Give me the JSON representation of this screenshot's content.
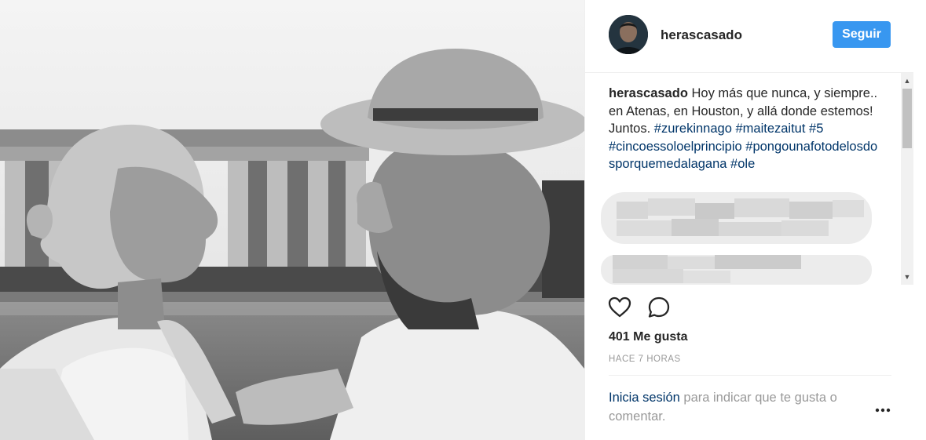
{
  "photo": {
    "alt_icon": "photo"
  },
  "header": {
    "username": "herascasado",
    "follow_label": "Seguir"
  },
  "caption": {
    "username": "herascasado",
    "text": "Hoy más que nunca, y siempre.. en Atenas, en Houston, y allá donde estemos! Juntos.",
    "hashtags": [
      "#zurekinnago",
      "#maitezaitut",
      "#5",
      "#cincoessoloelprincipio",
      "#pongounafotodelosdosporquemedalagana",
      "#ole"
    ]
  },
  "actions": {
    "like_icon": "heart-icon",
    "comment_icon": "comment-icon",
    "likes": "401 Me gusta",
    "time": "HACE 7 HORAS"
  },
  "footer": {
    "login_link": "Inicia sesión",
    "login_text": "para indicar que te gusta o comentar.",
    "more_icon": "more-options-icon"
  },
  "colors": {
    "accent": "#3897f0",
    "link": "#003569",
    "muted": "#999999",
    "text": "#262626"
  }
}
